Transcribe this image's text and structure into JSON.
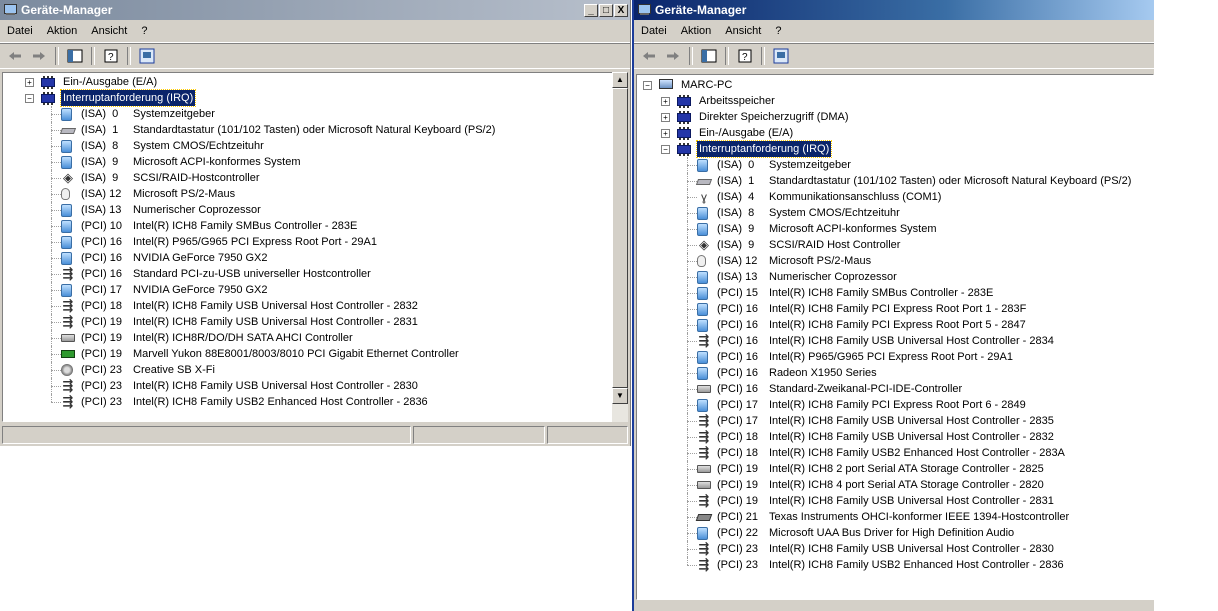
{
  "win1": {
    "title": "Geräte-Manager",
    "ctrl": {
      "min": "_",
      "max": "□",
      "close": "X"
    },
    "menu": [
      "Datei",
      "Aktion",
      "Ansicht",
      "?"
    ],
    "tree": [
      {
        "level": 1,
        "expander": "+",
        "icon": "chip",
        "label": "Ein-/Ausgabe (E/A)"
      },
      {
        "level": 1,
        "expander": "−",
        "icon": "chip",
        "label": "Interruptanforderung (IRQ)",
        "selected": true
      },
      {
        "level": 2,
        "icon": "system",
        "res": "(ISA)  0",
        "label": "Systemzeitgeber"
      },
      {
        "level": 2,
        "icon": "keyboard",
        "res": "(ISA)  1",
        "label": "Standardtastatur (101/102 Tasten) oder Microsoft Natural Keyboard (PS/2)"
      },
      {
        "level": 2,
        "icon": "system",
        "res": "(ISA)  8",
        "label": "System CMOS/Echtzeituhr"
      },
      {
        "level": 2,
        "icon": "system",
        "res": "(ISA)  9",
        "label": "Microsoft ACPI-konformes System"
      },
      {
        "level": 2,
        "icon": "scsi",
        "res": "(ISA)  9",
        "label": "SCSI/RAID-Hostcontroller"
      },
      {
        "level": 2,
        "icon": "mouse",
        "res": "(ISA) 12",
        "label": "Microsoft PS/2-Maus"
      },
      {
        "level": 2,
        "icon": "system",
        "res": "(ISA) 13",
        "label": "Numerischer Coprozessor"
      },
      {
        "level": 2,
        "icon": "system",
        "res": "(PCI) 10",
        "label": "Intel(R) ICH8 Family SMBus Controller - 283E"
      },
      {
        "level": 2,
        "icon": "system",
        "res": "(PCI) 16",
        "label": "Intel(R) P965/G965 PCI Express Root Port - 29A1"
      },
      {
        "level": 2,
        "icon": "system",
        "res": "(PCI) 16",
        "label": "NVIDIA GeForce 7950 GX2"
      },
      {
        "level": 2,
        "icon": "usb",
        "res": "(PCI) 16",
        "label": "Standard PCI-zu-USB universeller Hostcontroller"
      },
      {
        "level": 2,
        "icon": "system",
        "res": "(PCI) 17",
        "label": "NVIDIA GeForce 7950 GX2"
      },
      {
        "level": 2,
        "icon": "usb",
        "res": "(PCI) 18",
        "label": "Intel(R) ICH8 Family USB Universal Host Controller - 2832"
      },
      {
        "level": 2,
        "icon": "usb",
        "res": "(PCI) 19",
        "label": "Intel(R) ICH8 Family USB Universal Host Controller - 2831"
      },
      {
        "level": 2,
        "icon": "disk",
        "res": "(PCI) 19",
        "label": "Intel(R) ICH8R/DO/DH SATA AHCI Controller"
      },
      {
        "level": 2,
        "icon": "net",
        "res": "(PCI) 19",
        "label": "Marvell Yukon 88E8001/8003/8010 PCI Gigabit Ethernet Controller"
      },
      {
        "level": 2,
        "icon": "sound",
        "res": "(PCI) 23",
        "label": "Creative SB X-Fi"
      },
      {
        "level": 2,
        "icon": "usb",
        "res": "(PCI) 23",
        "label": "Intel(R) ICH8 Family USB Universal Host Controller - 2830"
      },
      {
        "level": 2,
        "icon": "usb",
        "res": "(PCI) 23",
        "label": "Intel(R) ICH8 Family USB2 Enhanced Host Controller - 2836"
      }
    ]
  },
  "win2": {
    "title": "Geräte-Manager",
    "menu": [
      "Datei",
      "Aktion",
      "Ansicht",
      "?"
    ],
    "tree": [
      {
        "level": 0,
        "expander": "−",
        "icon": "pc",
        "label": "MARC-PC"
      },
      {
        "level": 1,
        "expander": "+",
        "icon": "chip",
        "label": "Arbeitsspeicher"
      },
      {
        "level": 1,
        "expander": "+",
        "icon": "chip",
        "label": "Direkter Speicherzugriff (DMA)"
      },
      {
        "level": 1,
        "expander": "+",
        "icon": "chip",
        "label": "Ein-/Ausgabe (E/A)"
      },
      {
        "level": 1,
        "expander": "−",
        "icon": "chip",
        "label": "Interruptanforderung (IRQ)",
        "selected": true
      },
      {
        "level": 2,
        "icon": "system",
        "res": "(ISA)  0",
        "label": "Systemzeitgeber"
      },
      {
        "level": 2,
        "icon": "keyboard",
        "res": "(ISA)  1",
        "label": "Standardtastatur (101/102 Tasten) oder Microsoft Natural Keyboard (PS/2)"
      },
      {
        "level": 2,
        "icon": "port",
        "res": "(ISA)  4",
        "label": "Kommunikationsanschluss (COM1)"
      },
      {
        "level": 2,
        "icon": "system",
        "res": "(ISA)  8",
        "label": "System CMOS/Echtzeituhr"
      },
      {
        "level": 2,
        "icon": "system",
        "res": "(ISA)  9",
        "label": "Microsoft ACPI-konformes System"
      },
      {
        "level": 2,
        "icon": "scsi",
        "res": "(ISA)  9",
        "label": "SCSI/RAID Host Controller"
      },
      {
        "level": 2,
        "icon": "mouse",
        "res": "(ISA) 12",
        "label": "Microsoft PS/2-Maus"
      },
      {
        "level": 2,
        "icon": "system",
        "res": "(ISA) 13",
        "label": "Numerischer Coprozessor"
      },
      {
        "level": 2,
        "icon": "system",
        "res": "(PCI) 15",
        "label": "Intel(R) ICH8 Family SMBus Controller - 283E"
      },
      {
        "level": 2,
        "icon": "system",
        "res": "(PCI) 16",
        "label": "Intel(R) ICH8 Family PCI Express Root Port 1 - 283F"
      },
      {
        "level": 2,
        "icon": "system",
        "res": "(PCI) 16",
        "label": "Intel(R) ICH8 Family PCI Express Root Port 5 - 2847"
      },
      {
        "level": 2,
        "icon": "usb",
        "res": "(PCI) 16",
        "label": "Intel(R) ICH8 Family USB Universal Host Controller - 2834"
      },
      {
        "level": 2,
        "icon": "system",
        "res": "(PCI) 16",
        "label": "Intel(R) P965/G965 PCI Express Root Port - 29A1"
      },
      {
        "level": 2,
        "icon": "system",
        "res": "(PCI) 16",
        "label": "Radeon X1950 Series"
      },
      {
        "level": 2,
        "icon": "disk",
        "res": "(PCI) 16",
        "label": "Standard-Zweikanal-PCI-IDE-Controller"
      },
      {
        "level": 2,
        "icon": "system",
        "res": "(PCI) 17",
        "label": "Intel(R) ICH8 Family PCI Express Root Port 6 - 2849"
      },
      {
        "level": 2,
        "icon": "usb",
        "res": "(PCI) 17",
        "label": "Intel(R) ICH8 Family USB Universal Host Controller - 2835"
      },
      {
        "level": 2,
        "icon": "usb",
        "res": "(PCI) 18",
        "label": "Intel(R) ICH8 Family USB Universal Host Controller - 2832"
      },
      {
        "level": 2,
        "icon": "usb",
        "res": "(PCI) 18",
        "label": "Intel(R) ICH8 Family USB2 Enhanced Host Controller - 283A"
      },
      {
        "level": 2,
        "icon": "disk",
        "res": "(PCI) 19",
        "label": "Intel(R) ICH8 2 port Serial ATA Storage Controller - 2825"
      },
      {
        "level": 2,
        "icon": "disk",
        "res": "(PCI) 19",
        "label": "Intel(R) ICH8 4 port Serial ATA Storage Controller - 2820"
      },
      {
        "level": 2,
        "icon": "usb",
        "res": "(PCI) 19",
        "label": "Intel(R) ICH8 Family USB Universal Host Controller - 2831"
      },
      {
        "level": 2,
        "icon": "1394",
        "res": "(PCI) 21",
        "label": "Texas Instruments OHCI-konformer IEEE 1394-Hostcontroller"
      },
      {
        "level": 2,
        "icon": "system",
        "res": "(PCI) 22",
        "label": "Microsoft UAA Bus Driver for High Definition Audio"
      },
      {
        "level": 2,
        "icon": "usb",
        "res": "(PCI) 23",
        "label": "Intel(R) ICH8 Family USB Universal Host Controller - 2830"
      },
      {
        "level": 2,
        "icon": "usb",
        "res": "(PCI) 23",
        "label": "Intel(R) ICH8 Family USB2 Enhanced Host Controller - 2836"
      }
    ]
  }
}
